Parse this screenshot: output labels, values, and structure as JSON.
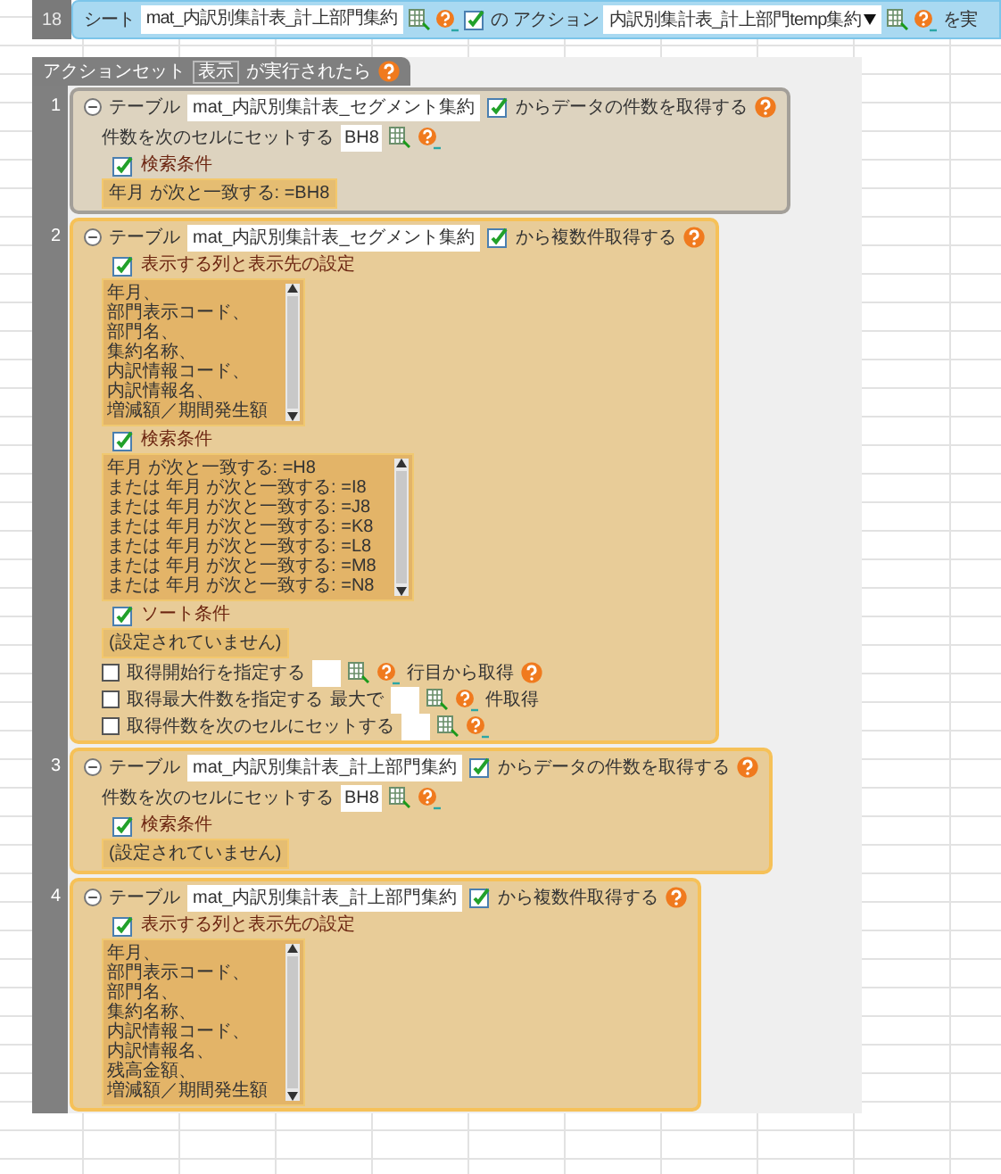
{
  "top_row": {
    "row_number": "18",
    "sheet_label": "シート",
    "sheet_value": "mat_内訳別集計表_計上部門集約",
    "of_label": "の",
    "action_label": "アクション",
    "action_value": "内訳別集計表_計上部門temp集約",
    "trailing": "を実"
  },
  "action_set": {
    "prefix": "アクションセット",
    "name": "表示",
    "suffix": "が実行されたら"
  },
  "steps": [
    {
      "kind": "count",
      "number": "1",
      "selected": true,
      "table_label": "テーブル",
      "table_value": "mat_内訳別集計表_セグメント集約",
      "action_text": "からデータの件数を取得する",
      "cell_label": "件数を次のセルにセットする",
      "cell_value": "BH8",
      "conditions": {
        "label": "検索条件",
        "text": "年月 が次と一致する: =BH8"
      }
    },
    {
      "kind": "multi",
      "number": "2",
      "selected": false,
      "table_label": "テーブル",
      "table_value": "mat_内訳別集計表_セグメント集約",
      "action_text": "から複数件取得する",
      "columns": {
        "label": "表示する列と表示先の設定",
        "items": [
          "年月、",
          "部門表示コード、",
          "部門名、",
          "集約名称、",
          "内訳情報コード、",
          "内訳情報名、",
          "増減額／期間発生額"
        ]
      },
      "conditions": {
        "label": "検索条件",
        "items": [
          "年月 が次と一致する: =H8",
          "または 年月 が次と一致する: =I8",
          "または 年月 が次と一致する: =J8",
          "または 年月 が次と一致する: =K8",
          "または 年月 が次と一致する: =L8",
          "または 年月 が次と一致する: =M8",
          "または 年月 が次と一致する: =N8"
        ]
      },
      "sort": {
        "label": "ソート条件",
        "text": "(設定されていません)"
      },
      "options": [
        {
          "label": "取得開始行を指定する",
          "checked": false,
          "suffix": "行目から取得",
          "help_icon": true
        },
        {
          "label": "取得最大件数を指定する",
          "checked": false,
          "prefix": "最大で",
          "suffix": "件取得",
          "help_icon": false
        },
        {
          "label": "取得件数を次のセルにセットする",
          "checked": false,
          "help_icon": false
        }
      ]
    },
    {
      "kind": "count",
      "number": "3",
      "selected": false,
      "table_label": "テーブル",
      "table_value": "mat_内訳別集計表_計上部門集約",
      "action_text": "からデータの件数を取得する",
      "cell_label": "件数を次のセルにセットする",
      "cell_value": "BH8",
      "conditions": {
        "label": "検索条件",
        "text": "(設定されていません)"
      }
    },
    {
      "kind": "multi",
      "number": "4",
      "selected": false,
      "table_label": "テーブル",
      "table_value": "mat_内訳別集計表_計上部門集約",
      "action_text": "から複数件取得する",
      "columns": {
        "label": "表示する列と表示先の設定",
        "items": [
          "年月、",
          "部門表示コード、",
          "部門名、",
          "集約名称、",
          "内訳情報コード、",
          "内訳情報名、",
          "残高金額、",
          "増減額／期間発生額"
        ]
      }
    }
  ]
}
